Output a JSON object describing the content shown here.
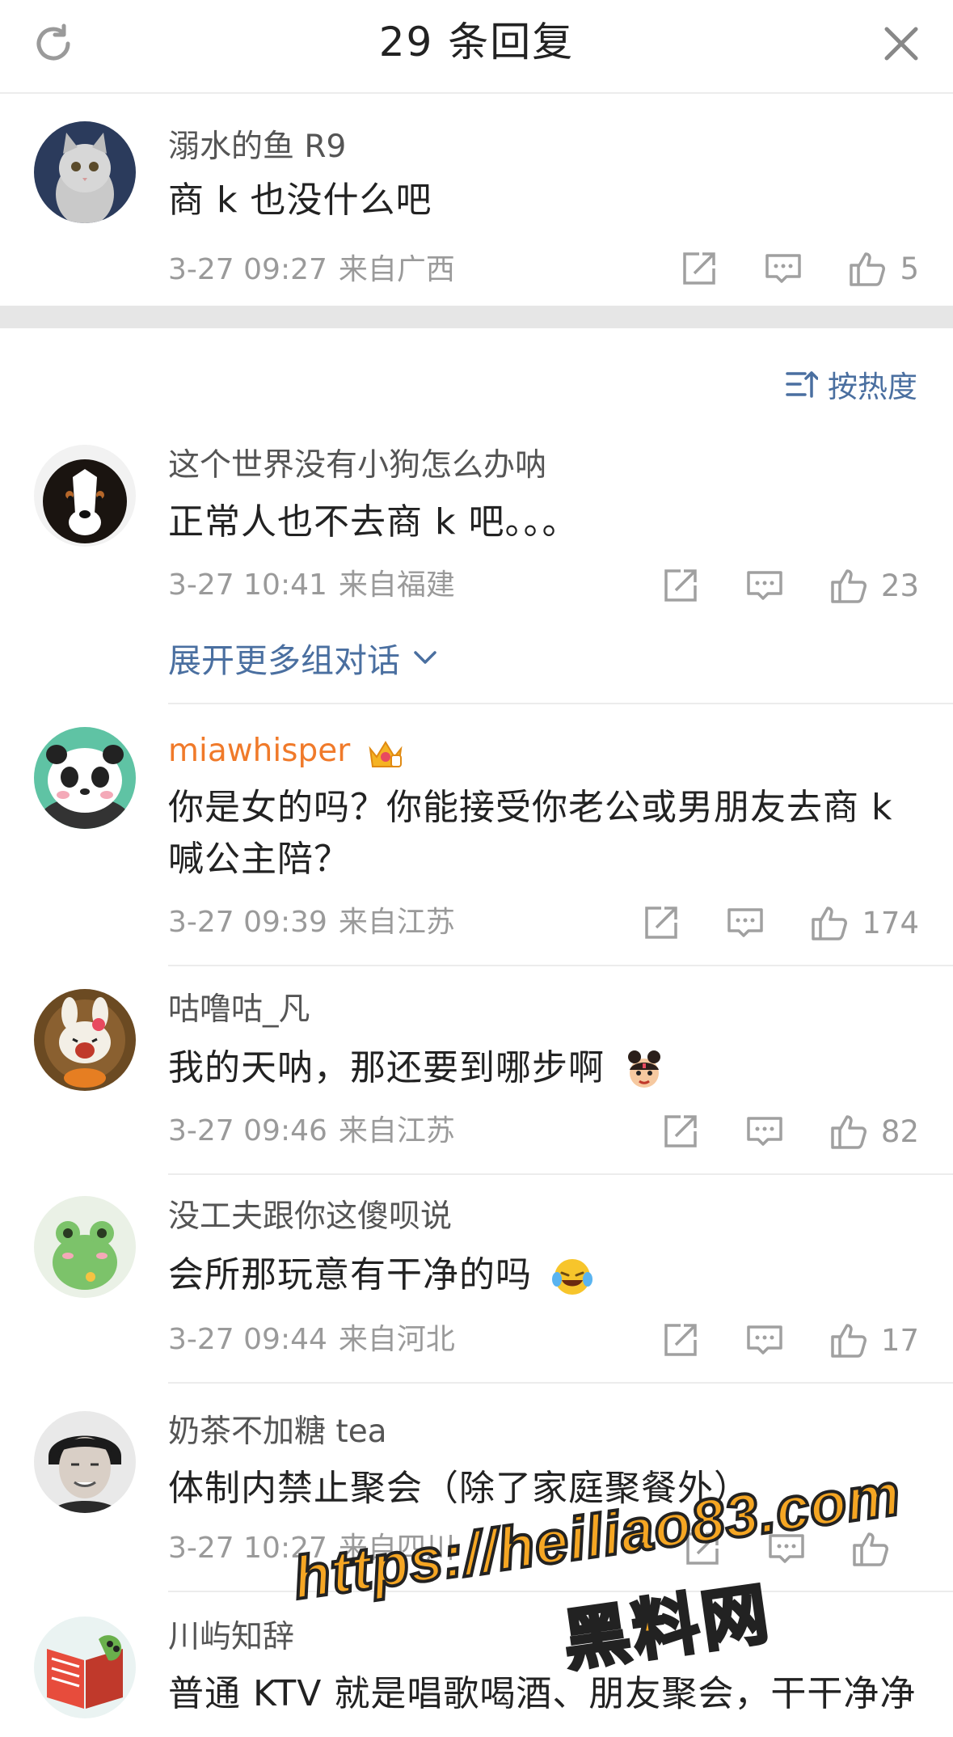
{
  "header": {
    "title": "29 条回复",
    "refresh_icon": "refresh-icon",
    "close_icon": "close-icon"
  },
  "root_comment": {
    "username": "溺水的鱼 R9",
    "content": "商 k 也没什么吧",
    "time": "3-27 09:27",
    "location": "来自广西",
    "likes": "5"
  },
  "sort": {
    "label": "按热度"
  },
  "expand_label": "展开更多组对话",
  "replies": [
    {
      "username": "这个世界没有小狗怎么办呐",
      "content": "正常人也不去商 k 吧。。。",
      "time": "3-27 10:41",
      "location": "来自福建",
      "likes": "23"
    },
    {
      "username": "miawhisper",
      "content": "你是女的吗？你能接受你老公或男朋友去商 k 喊公主陪？",
      "time": "3-27 09:39",
      "location": "来自江苏",
      "likes": "174"
    },
    {
      "username": "咕噜咕_凡",
      "content": "我的天呐，那还要到哪步啊",
      "time": "3-27 09:46",
      "location": "来自江苏",
      "likes": "82"
    },
    {
      "username": "没工夫跟你这傻呗说",
      "content": "会所那玩意有干净的吗",
      "time": "3-27 09:44",
      "location": "来自河北",
      "likes": "17"
    },
    {
      "username": "奶茶不加糖 tea",
      "content": "体制内禁止聚会（除了家庭聚餐外）",
      "time": "3-27 10:27",
      "location": "来自四川",
      "likes": ""
    },
    {
      "username": "川屿知辞",
      "content": "普通 KTV 就是唱歌喝酒、朋友聚会，干干净净",
      "time": "",
      "location": "",
      "likes": ""
    }
  ],
  "watermark": {
    "url": "https://heiliao83.com",
    "name": "黑料网"
  },
  "colors": {
    "link": "#4a6fa0",
    "vip_name": "#f07a2a",
    "meta": "#9a9a9a",
    "divider": "#ececec",
    "band": "#e6e6e6"
  }
}
